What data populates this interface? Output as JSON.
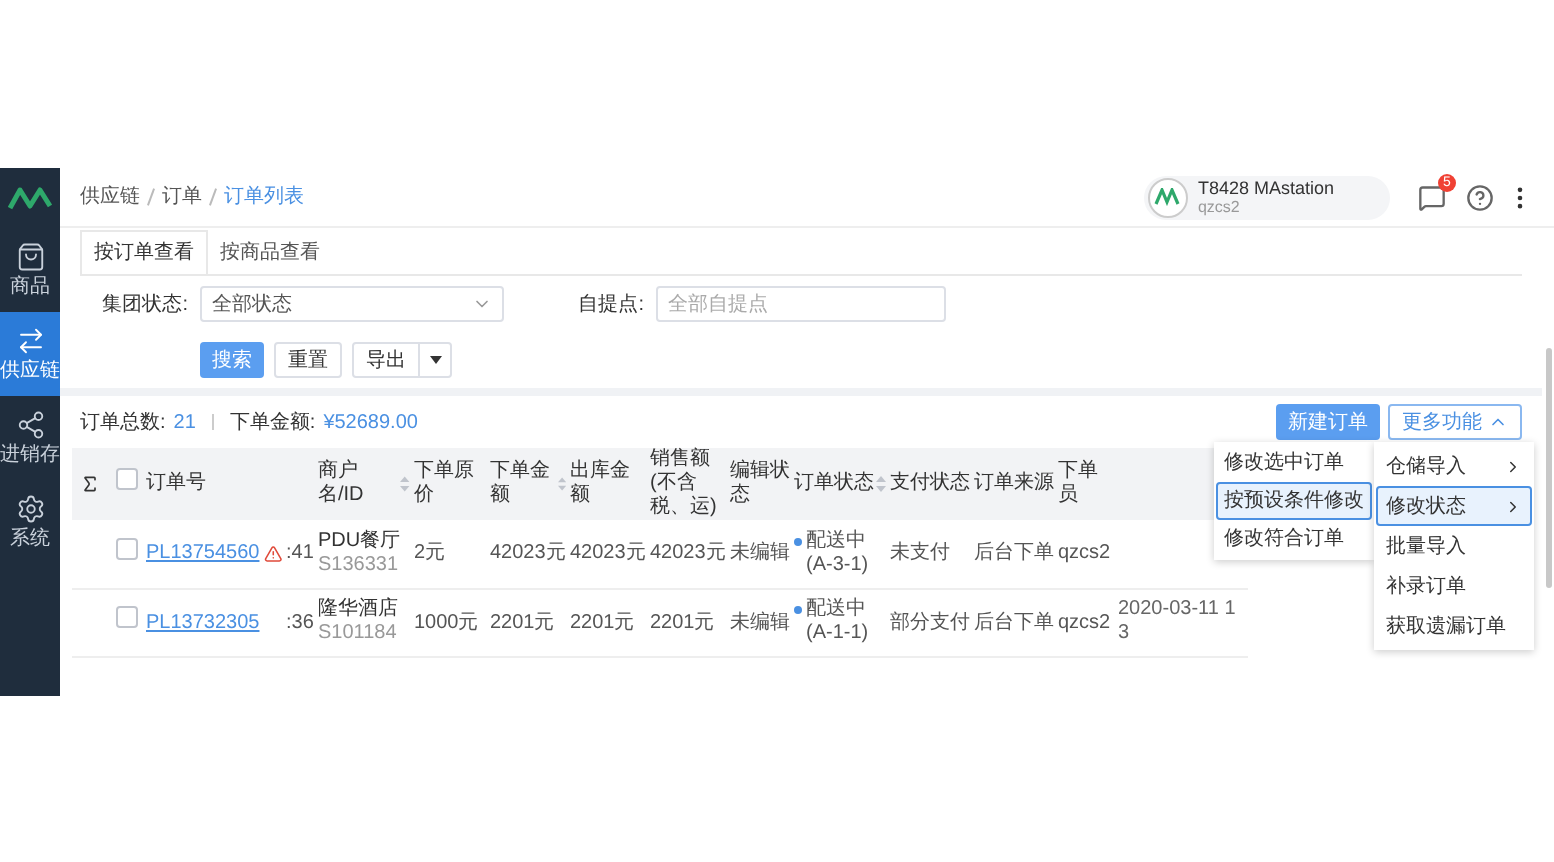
{
  "sidebar": {
    "items": [
      {
        "label": "商品",
        "selected": false
      },
      {
        "label": "供应链",
        "selected": true
      },
      {
        "label": "进销存",
        "selected": false
      },
      {
        "label": "系统",
        "selected": false
      }
    ]
  },
  "header": {
    "breadcrumb": [
      "供应链",
      "订单",
      "订单列表"
    ],
    "user": {
      "name": "T8428 MAstation",
      "account": "qzcs2"
    },
    "notification_badge": "5"
  },
  "tabs": [
    {
      "label": "按订单查看",
      "selected": true
    },
    {
      "label": "按商品查看",
      "selected": false
    }
  ],
  "filters": [
    {
      "kind": "select",
      "label": "集团状态:",
      "value": "全部状态"
    },
    {
      "kind": "input",
      "label": "自提点:",
      "placeholder": "全部自提点"
    }
  ],
  "filter_buttons": {
    "search": "搜索",
    "reset": "重置",
    "export": "导出"
  },
  "summary": {
    "count_label": "订单总数:",
    "count": "21",
    "amount_label": "下单金额:",
    "amount": "¥52689.00"
  },
  "toolbar": {
    "new_order": "新建订单",
    "more": "更多功能",
    "more_expanded": true
  },
  "more_menu": {
    "items": [
      {
        "label": "仓储导入",
        "has_submenu": true,
        "selected": false
      },
      {
        "label": "修改状态",
        "has_submenu": true,
        "selected": true
      },
      {
        "label": "批量导入",
        "has_submenu": false,
        "selected": false
      },
      {
        "label": "补录订单",
        "has_submenu": false,
        "selected": false
      },
      {
        "label": "获取遗漏订单",
        "has_submenu": false,
        "selected": false
      }
    ],
    "submenu": [
      {
        "label": "修改选中订单",
        "selected": false
      },
      {
        "label": "按预设条件修改",
        "selected": true
      },
      {
        "label": "修改符合订单",
        "selected": false
      }
    ]
  },
  "table": {
    "header_checked": false,
    "columns": [
      {
        "label": "订单号",
        "sortable": false
      },
      {
        "label": "商户名/ID",
        "sortable": true
      },
      {
        "label": "下单原价",
        "sortable": false
      },
      {
        "label": "下单金额",
        "sortable": true
      },
      {
        "label": "出库金额",
        "sortable": false
      },
      {
        "label": "销售额(不含税、运)",
        "sortable": false
      },
      {
        "label": "编辑状态",
        "sortable": false
      },
      {
        "label": "订单状态",
        "sortable": true
      },
      {
        "label": "支付状态",
        "sortable": false
      },
      {
        "label": "订单来源",
        "sortable": false
      },
      {
        "label": "下单员",
        "sortable": false
      }
    ],
    "rows": [
      {
        "checked": false,
        "warning": true,
        "order_no": "PL13754560",
        "column_3": ":41",
        "merchant": {
          "name": "PDU餐厅",
          "id": "S136331"
        },
        "original_price": "2元",
        "order_amount": "42023元",
        "outbound_amount": "42023元",
        "sales_amount": "42023元",
        "edit_status": "未编辑",
        "order_status": "配送中(A-3-1)",
        "payment_status": "未支付",
        "source": "后台下单",
        "placer": "qzcs2"
      },
      {
        "checked": false,
        "warning": false,
        "order_no": "PL13732305",
        "column_3": ":36",
        "merchant": {
          "name": "隆华酒店",
          "id": "S101184"
        },
        "original_price": "1000元",
        "order_amount": "2201元",
        "outbound_amount": "2201元",
        "sales_amount": "2201元",
        "edit_status": "未编辑",
        "order_status": "配送中(A-1-1)",
        "payment_status": "部分支付",
        "source": "后台下单",
        "placer": "qzcs2",
        "column_15": [
          "2020-03-11 1",
          "3"
        ]
      }
    ]
  }
}
